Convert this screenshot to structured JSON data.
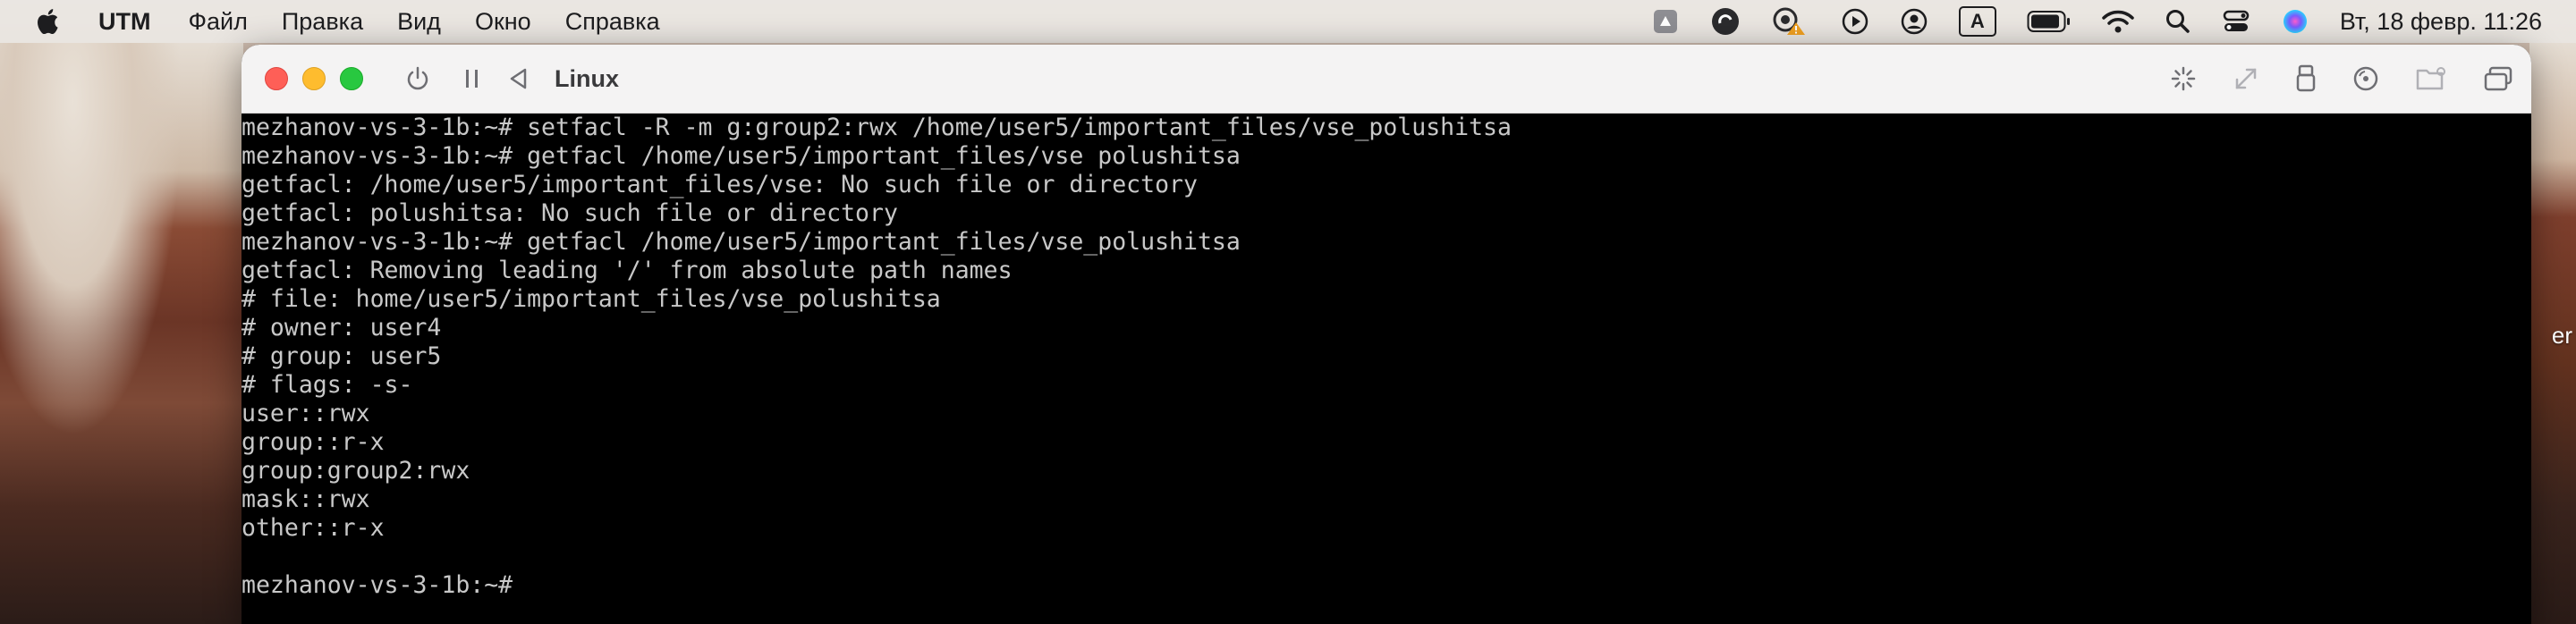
{
  "menubar": {
    "app_name": "UTM",
    "menus": [
      "Файл",
      "Правка",
      "Вид",
      "Окно",
      "Справка"
    ],
    "input_source": "A",
    "clock": "Вт, 18 февр.  11:26",
    "status_icons": [
      "drive-icon",
      "creative-cloud-icon",
      "cloud-alert-icon",
      "play-circle-icon",
      "user-circle-icon",
      "keyboard-layout-icon",
      "battery-icon",
      "wifi-icon",
      "search-icon",
      "control-center-icon",
      "siri-icon"
    ]
  },
  "window": {
    "title": "Linux",
    "toolbar_icons": [
      "power-icon",
      "pause-icon",
      "back-icon",
      "spinner-icon",
      "resize-icon",
      "usb-icon",
      "disk-icon",
      "folder-icon",
      "windows-icon"
    ]
  },
  "terminal": {
    "lines": [
      "mezhanov-vs-3-1b:~# setfacl -R -m g:group2:rwx /home/user5/important_files/vse_polushitsa",
      "mezhanov-vs-3-1b:~# getfacl /home/user5/important_files/vse polushitsa",
      "getfacl: /home/user5/important_files/vse: No such file or directory",
      "getfacl: polushitsa: No such file or directory",
      "mezhanov-vs-3-1b:~# getfacl /home/user5/important_files/vse_polushitsa",
      "getfacl: Removing leading '/' from absolute path names",
      "# file: home/user5/important_files/vse_polushitsa",
      "# owner: user4",
      "# group: user5",
      "# flags: -s-",
      "user::rwx",
      "group::r-x",
      "group:group2:rwx",
      "mask::rwx",
      "other::r-x",
      "",
      "mezhanov-vs-3-1b:~#"
    ]
  },
  "desktop": {
    "partial_label": "er"
  }
}
